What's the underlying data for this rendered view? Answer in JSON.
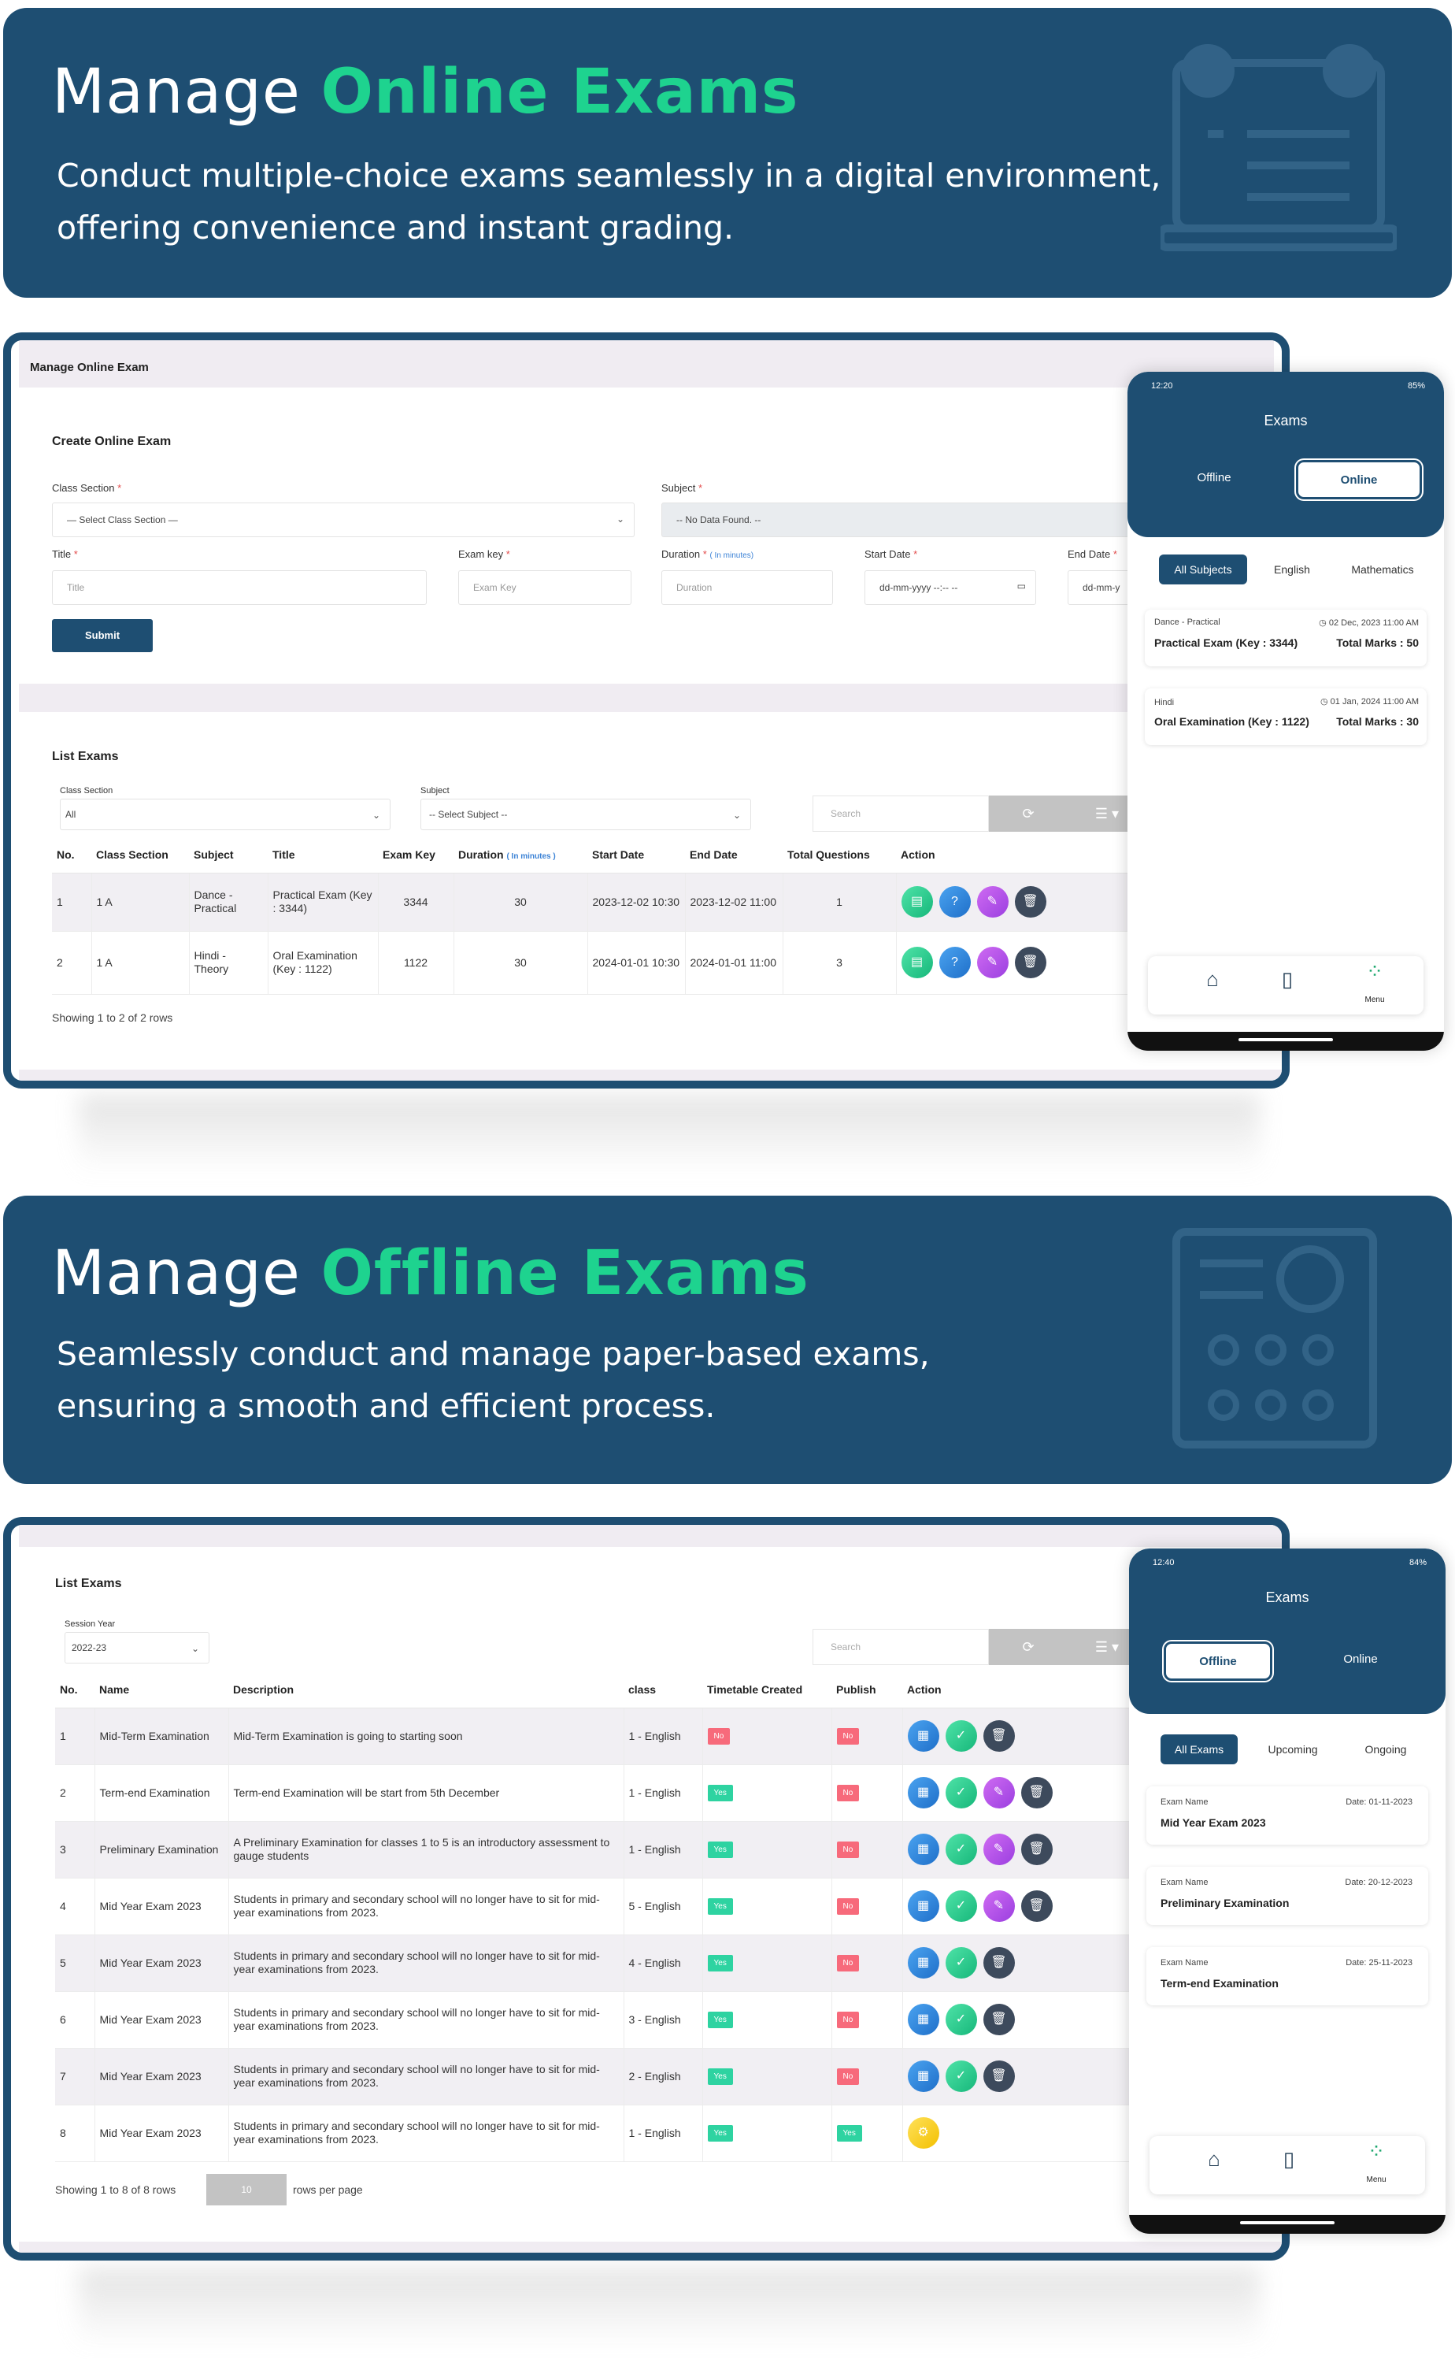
{
  "hero_online": {
    "title_plain": "Manage ",
    "title_accent": "Online Exams",
    "line1": "Conduct multiple-choice exams seamlessly in a digital environment,",
    "line2": "offering convenience and instant grading."
  },
  "hero_offline": {
    "title_plain": "Manage ",
    "title_accent": "Offline Exams",
    "line1": "Seamlessly conduct and manage paper-based exams,",
    "line2": "ensuring a smooth and efficient process."
  },
  "online_panel": {
    "header": "Manage Online Exam",
    "create_title": "Create Online Exam",
    "class_section_label": "Class Section",
    "class_section_value": "— Select Class Section —",
    "subject_label": "Subject",
    "subject_value": "-- No Data Found. --",
    "title_label": "Title",
    "title_placeholder": "Title",
    "exam_key_label": "Exam key",
    "exam_key_placeholder": "Exam Key",
    "duration_label": "Duration",
    "duration_hint": "( In minutes)",
    "duration_placeholder": "Duration",
    "start_date_label": "Start Date",
    "start_date_value": "dd-mm-yyyy --:-- --",
    "end_date_label": "End Date",
    "end_date_value": "dd-mm-y",
    "required_mark": "*",
    "submit_label": "Submit",
    "list_title": "List Exams",
    "filter_class_label": "Class Section",
    "filter_class_value": "All",
    "filter_subject_label": "Subject",
    "filter_subject_value": "-- Select Subject --",
    "search_placeholder": "Search",
    "columns": [
      "No.",
      "Class Section",
      "Subject",
      "Title",
      "Exam Key",
      "Duration",
      "Start Date",
      "End Date",
      "Total Questions",
      "Action"
    ],
    "duration_col_hint": "( In minutes )",
    "rows": [
      {
        "no": "1",
        "class_section": "1 A",
        "subject": "Dance - Practical",
        "title": "Practical Exam (Key : 3344)",
        "exam_key": "3344",
        "duration": "30",
        "start": "2023-12-02 10:30",
        "end": "2023-12-02 11:00",
        "questions": "1"
      },
      {
        "no": "2",
        "class_section": "1 A",
        "subject": "Hindi - Theory",
        "title": "Oral Examination (Key : 1122)",
        "exam_key": "1122",
        "duration": "30",
        "start": "2024-01-01 10:30",
        "end": "2024-01-01 11:00",
        "questions": "3"
      }
    ],
    "footer": "Showing 1 to 2 of 2 rows"
  },
  "phone_online": {
    "time": "12:20",
    "battery": "85%",
    "title": "Exams",
    "toggle_offline": "Offline",
    "toggle_online": "Online",
    "chips": [
      "All Subjects",
      "English",
      "Mathematics"
    ],
    "cards": [
      {
        "subject": "Dance - Practical",
        "date": "02 Dec, 2023 11:00 AM",
        "name": "Practical Exam (Key : 3344)",
        "marks": "Total Marks : 50"
      },
      {
        "subject": "Hindi",
        "date": "01 Jan, 2024 11:00 AM",
        "name": "Oral Examination (Key : 1122)",
        "marks": "Total Marks : 30"
      }
    ],
    "nav_menu_label": "Menu"
  },
  "offline_panel": {
    "list_title": "List Exams",
    "session_label": "Session Year",
    "session_value": "2022-23",
    "search_placeholder": "Search",
    "columns": [
      "No.",
      "Name",
      "Description",
      "class",
      "Timetable Created",
      "Publish",
      "Action"
    ],
    "rows": [
      {
        "no": "1",
        "name": "Mid-Term Examination",
        "description": "Mid-Term Examination is going to starting soon",
        "class": "1 - English",
        "timetable": "No",
        "publish": "No",
        "actions": [
          "blue",
          "green",
          "dark"
        ]
      },
      {
        "no": "2",
        "name": "Term-end Examination",
        "description": "Term-end Examination will be start from 5th December",
        "class": "1 - English",
        "timetable": "Yes",
        "publish": "No",
        "actions": [
          "blue",
          "green",
          "purple",
          "dark"
        ]
      },
      {
        "no": "3",
        "name": "Preliminary Examination",
        "description": "A Preliminary Examination for classes 1 to 5 is an introductory assessment to gauge students",
        "class": "1 - English",
        "timetable": "Yes",
        "publish": "No",
        "actions": [
          "blue",
          "green",
          "purple",
          "dark"
        ]
      },
      {
        "no": "4",
        "name": "Mid Year Exam 2023",
        "description": "Students in primary and secondary school will no longer have to sit for mid-year examinations from 2023.",
        "class": "5 - English",
        "timetable": "Yes",
        "publish": "No",
        "actions": [
          "blue",
          "green",
          "purple",
          "dark"
        ]
      },
      {
        "no": "5",
        "name": "Mid Year Exam 2023",
        "description": "Students in primary and secondary school will no longer have to sit for mid-year examinations from 2023.",
        "class": "4 - English",
        "timetable": "Yes",
        "publish": "No",
        "actions": [
          "blue",
          "green",
          "dark"
        ]
      },
      {
        "no": "6",
        "name": "Mid Year Exam 2023",
        "description": "Students in primary and secondary school will no longer have to sit for mid-year examinations from 2023.",
        "class": "3 - English",
        "timetable": "Yes",
        "publish": "No",
        "actions": [
          "blue",
          "green",
          "dark"
        ]
      },
      {
        "no": "7",
        "name": "Mid Year Exam 2023",
        "description": "Students in primary and secondary school will no longer have to sit for mid-year examinations from 2023.",
        "class": "2 - English",
        "timetable": "Yes",
        "publish": "No",
        "actions": [
          "blue",
          "green",
          "dark"
        ]
      },
      {
        "no": "8",
        "name": "Mid Year Exam 2023",
        "description": "Students in primary and secondary school will no longer have to sit for mid-year examinations from 2023.",
        "class": "1 - English",
        "timetable": "Yes",
        "publish": "Yes",
        "actions": [
          "yellow"
        ]
      }
    ],
    "footer": "Showing 1 to 8 of 8 rows",
    "page_size": "10",
    "rows_per_page": "rows per page"
  },
  "phone_offline": {
    "time": "12:40",
    "battery": "84%",
    "title": "Exams",
    "toggle_offline": "Offline",
    "toggle_online": "Online",
    "chips": [
      "All Exams",
      "Upcoming",
      "Ongoing"
    ],
    "cards": [
      {
        "label": "Exam Name",
        "date": "Date: 01-11-2023",
        "name": "Mid Year Exam 2023"
      },
      {
        "label": "Exam Name",
        "date": "Date: 20-12-2023",
        "name": "Preliminary Examination"
      },
      {
        "label": "Exam Name",
        "date": "Date: 25-11-2023",
        "name": "Term-end Examination"
      }
    ],
    "nav_menu_label": "Menu"
  },
  "colors": {
    "brand": "#1e4e72",
    "accent": "#1ed38f"
  },
  "icons": [
    "home-icon",
    "book-icon",
    "menu-grid-icon",
    "refresh-icon",
    "list-icon",
    "calendar-icon",
    "check-icon",
    "edit-icon",
    "trash-icon",
    "document-icon",
    "help-icon",
    "clock-icon"
  ]
}
